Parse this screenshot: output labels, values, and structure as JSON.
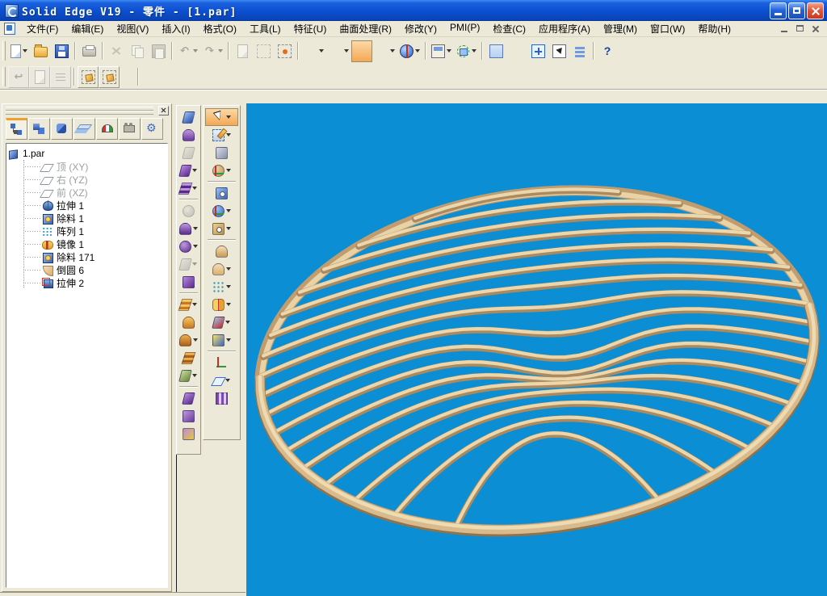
{
  "window": {
    "title": "Solid Edge V19 - 零件 - [1.par]"
  },
  "titlebar": {
    "icons": [
      "app-icon",
      "minimize-icon",
      "restore-icon",
      "close-icon"
    ]
  },
  "menu": {
    "items": [
      {
        "key": "file",
        "label": "文件(F)"
      },
      {
        "key": "edit",
        "label": "编辑(E)"
      },
      {
        "key": "view",
        "label": "视图(V)"
      },
      {
        "key": "insert",
        "label": "插入(I)"
      },
      {
        "key": "format",
        "label": "格式(O)"
      },
      {
        "key": "tools",
        "label": "工具(L)"
      },
      {
        "key": "features",
        "label": "特征(U)"
      },
      {
        "key": "surfacing",
        "label": "曲面处理(R)"
      },
      {
        "key": "modify",
        "label": "修改(Y)"
      },
      {
        "key": "pmi",
        "label": "PMI(P)"
      },
      {
        "key": "inspect",
        "label": "检查(C)"
      },
      {
        "key": "applications",
        "label": "应用程序(A)"
      },
      {
        "key": "manage",
        "label": "管理(M)"
      },
      {
        "key": "window",
        "label": "窗口(W)"
      },
      {
        "key": "help",
        "label": "帮助(H)"
      }
    ],
    "mdi_icons": [
      "mdi-minimize-icon",
      "mdi-restore-icon",
      "mdi-close-icon"
    ]
  },
  "toolbar_main": {
    "buttons": [
      {
        "name": "new",
        "icon": "page",
        "dd": true
      },
      {
        "name": "open",
        "icon": "folder"
      },
      {
        "name": "save",
        "icon": "floppy"
      },
      {
        "sep": true
      },
      {
        "name": "print",
        "icon": "printer"
      },
      {
        "sep": true
      },
      {
        "name": "cut",
        "icon": "xbars",
        "disabled": true
      },
      {
        "name": "copy",
        "icon": "copy",
        "disabled": true
      },
      {
        "name": "paste",
        "icon": "paste",
        "disabled": true
      },
      {
        "sep": true
      },
      {
        "name": "undo",
        "icon": "glyph",
        "glyph": "↶",
        "dd": true,
        "disabled": true
      },
      {
        "name": "redo",
        "icon": "glyph",
        "glyph": "↷",
        "dd": true,
        "disabled": true
      },
      {
        "sep": true
      },
      {
        "name": "insert-object",
        "icon": "page",
        "disabled": true
      },
      {
        "name": "select-options",
        "icon": "dashbox",
        "disabled": true
      },
      {
        "name": "deselect-all",
        "icon": "dashbox-dot"
      },
      {
        "sep": true
      },
      {
        "name": "wireframe-view",
        "icon": "cube",
        "dd": true
      },
      {
        "name": "hidden-edge-view",
        "icon": "cube",
        "dd": true
      },
      {
        "name": "shaded-view",
        "icon": "cube solid",
        "active": true
      },
      {
        "name": "shaded-edges-view",
        "icon": "cube soledge",
        "dd": true
      },
      {
        "name": "render-view",
        "icon": "globe",
        "dd": true
      },
      {
        "sep": true
      },
      {
        "name": "named-views",
        "icon": "namedv",
        "dd": true
      },
      {
        "name": "rotate-view",
        "icon": "rotcube",
        "dd": true
      },
      {
        "sep": true
      },
      {
        "name": "zoom-area",
        "icon": "zoomarea mag"
      },
      {
        "name": "zoom",
        "icon": "mag"
      },
      {
        "name": "fit",
        "icon": "fit"
      },
      {
        "name": "pan",
        "icon": "pan"
      },
      {
        "name": "previous-view",
        "icon": "stack"
      },
      {
        "sep": true
      },
      {
        "name": "help-pointer",
        "icon": "help",
        "glyph": "?"
      }
    ]
  },
  "toolbar_sketch": {
    "buttons": [
      {
        "name": "return",
        "icon": "return",
        "raised": true,
        "disabled": true
      },
      {
        "name": "sketch-view",
        "icon": "page",
        "raised": true,
        "disabled": true
      },
      {
        "name": "dimension-display",
        "icon": "dim",
        "raised": true,
        "disabled": true
      },
      {
        "sep": true
      },
      {
        "name": "profile-display-on",
        "icon": "profile",
        "raised": true,
        "active": true
      },
      {
        "name": "profile-display-off",
        "icon": "profile",
        "raised": true
      }
    ]
  },
  "edgebar": {
    "close_icon": "close-icon",
    "tabs": [
      {
        "name": "pathfinder",
        "icon": "pathfinder",
        "active": true
      },
      {
        "name": "feature-library",
        "icon": "library"
      },
      {
        "name": "family-of-parts",
        "icon": "family"
      },
      {
        "name": "layers",
        "icon": "layers"
      },
      {
        "name": "sensors",
        "icon": "sensors"
      },
      {
        "name": "feature-playback",
        "icon": "playback"
      },
      {
        "name": "engineering-reference",
        "icon": "engineering"
      }
    ],
    "tree": {
      "root": {
        "name": "part-root",
        "label": "1.par",
        "kind": "part"
      },
      "items": [
        {
          "name": "plane-top",
          "label": "顶 (XY)",
          "kind": "plane",
          "gray": true
        },
        {
          "name": "plane-right",
          "label": "右 (YZ)",
          "kind": "plane",
          "gray": true
        },
        {
          "name": "plane-front",
          "label": "前 (XZ)",
          "kind": "plane",
          "gray": true
        },
        {
          "name": "extrude-1",
          "label": "拉伸 1",
          "kind": "extrude"
        },
        {
          "name": "cutout-1",
          "label": "除料 1",
          "kind": "cutout"
        },
        {
          "name": "pattern-1",
          "label": "阵列 1",
          "kind": "pattern"
        },
        {
          "name": "mirror-1",
          "label": "镜像 1",
          "kind": "mirror"
        },
        {
          "name": "cutout-171",
          "label": "除料 171",
          "kind": "cutout"
        },
        {
          "name": "round-6",
          "label": "倒圆 6",
          "kind": "round"
        },
        {
          "name": "extrude-2",
          "label": "拉伸 2",
          "kind": "extrude2"
        }
      ]
    }
  },
  "surfacing_toolbar": {
    "buttons": [
      {
        "name": "keypoint-curve",
        "shape": "slab",
        "c1": "#9cc0f0",
        "c2": "#2a50a8"
      },
      {
        "name": "derived-curve",
        "shape": "arc",
        "c1": "#c09ae0",
        "c2": "#6a3a9a"
      },
      {
        "name": "intersection-curve",
        "shape": "slab",
        "c1": "#d8d8d8",
        "c2": "#9a9a9a",
        "disabled": true
      },
      {
        "name": "extruded-surface",
        "shape": "slab",
        "c1": "#b88ae0",
        "c2": "#5a2a8a",
        "dd": true
      },
      {
        "name": "revolved-surface",
        "shape": "wave",
        "c1": "#c09ae0",
        "c2": "#5a2a8a",
        "dd": true
      },
      {
        "sep": true
      },
      {
        "name": "bounded-surface",
        "shape": "ball",
        "c1": "#e0e0e0",
        "c2": "#8a8a8a",
        "disabled": true
      },
      {
        "name": "offset-surface",
        "shape": "arc",
        "c1": "#c09ae0",
        "c2": "#5a2a8a",
        "dd": true
      },
      {
        "name": "copy-surface",
        "shape": "ball",
        "c1": "#c09ae0",
        "c2": "#5a2a8a",
        "dd": true
      },
      {
        "name": "stitched-surface",
        "shape": "slab",
        "c1": "#d8d8d8",
        "c2": "#9a9a9a",
        "dd": true,
        "disabled": true
      },
      {
        "name": "normal-protrusion",
        "shape": "cube",
        "c1": "#b88ae0",
        "c2": "#5a2a8a"
      },
      {
        "sep": true
      },
      {
        "name": "bluesurf",
        "shape": "wave",
        "c1": "#f8c868",
        "c2": "#c87820",
        "dd": true
      },
      {
        "name": "swept-surface",
        "shape": "arc",
        "c1": "#f8c868",
        "c2": "#c87820"
      },
      {
        "name": "lofted-surface",
        "shape": "arc",
        "c1": "#f0b050",
        "c2": "#a86018",
        "dd": true
      },
      {
        "name": "bounded-wave",
        "shape": "wave",
        "c1": "#f0b050",
        "c2": "#a86018"
      },
      {
        "name": "split-curve",
        "shape": "slab",
        "c1": "#c8d8a0",
        "c2": "#6a8a3a",
        "dd": true
      },
      {
        "sep": true
      },
      {
        "name": "trim-surface",
        "shape": "slab",
        "c1": "#b88ae0",
        "c2": "#5a2a8a"
      },
      {
        "name": "replace-face",
        "shape": "cube",
        "c1": "#c09ae0",
        "c2": "#6a3a9a"
      },
      {
        "name": "parting-surface",
        "shape": "cube",
        "c1": "#b88ae0",
        "c2": "#eac838"
      }
    ]
  },
  "feature_toolbar": {
    "buttons": [
      {
        "name": "select-tool",
        "shape": "cursor",
        "c1": "#ffffff",
        "c2": "#111111",
        "dd": true,
        "active": true
      },
      {
        "name": "sketch",
        "shape": "pencil",
        "c1": "#eaf2fc",
        "c2": "#3a6cc8",
        "dd": true
      },
      {
        "name": "extrude",
        "shape": "cube",
        "c1": "#d8dce8",
        "c2": "#8890a8"
      },
      {
        "name": "revolve",
        "shape": "ball axis",
        "c1": "#e8d0a0",
        "c2": "#b89058",
        "dd": true
      },
      {
        "sep": true
      },
      {
        "name": "cutout",
        "shape": "cube gi-hole",
        "c1": "#9cc0f0",
        "c2": "#3a66b8"
      },
      {
        "name": "revolved-cutout",
        "shape": "ball axis",
        "c1": "#9cc0f0",
        "c2": "#3a66b8",
        "dd": true
      },
      {
        "name": "hole",
        "shape": "cube gi-hole",
        "c1": "#f0d090",
        "c2": "#b89048",
        "dd": true
      },
      {
        "sep": true
      },
      {
        "name": "chamfer",
        "shape": "arc",
        "c1": "#f4e0b8",
        "c2": "#c89858"
      },
      {
        "name": "round",
        "shape": "arc",
        "c1": "#f4e0b8",
        "c2": "#d8ae6e",
        "dd": true
      },
      {
        "name": "pattern",
        "shape": "dots",
        "c1": "#ffffff",
        "c2": "#3a9ab8",
        "dd": true
      },
      {
        "name": "mirror",
        "shape": "mirror2",
        "c1": "#f8d060",
        "c2": "#e8a030",
        "dd": true
      },
      {
        "name": "add-draft",
        "shape": "slab",
        "c1": "#9cc0f0",
        "c2": "#c03028",
        "dd": true
      },
      {
        "name": "thin-wall",
        "shape": "cube",
        "c1": "#f8e070",
        "c2": "#3a66b8",
        "dd": true
      },
      {
        "sep": true
      },
      {
        "name": "coordinate-system",
        "shape": "axis",
        "c1": "#2a9a3a",
        "c2": "#c03028"
      },
      {
        "name": "reference-plane",
        "shape": "plane2",
        "c1": "#eaf2fc",
        "c2": "#3a6cc8",
        "dd": true
      },
      {
        "name": "construction-display",
        "shape": "fence",
        "c1": "#e0d0f0",
        "c2": "#7a4ab0"
      }
    ]
  },
  "viewport": {
    "background": "#0b8ed3",
    "model": {
      "name": "ribbed-dome-part",
      "rib_dark": "#ab8a60",
      "rib_light": "#ecd6ac",
      "rim_dark": "#c09c6e",
      "rim_light": "#e9d2a6",
      "rim_front_dark": "#8f734e",
      "rim_front_mid": "#d9ba8c",
      "rim_front_light": "#eedbb2"
    }
  }
}
